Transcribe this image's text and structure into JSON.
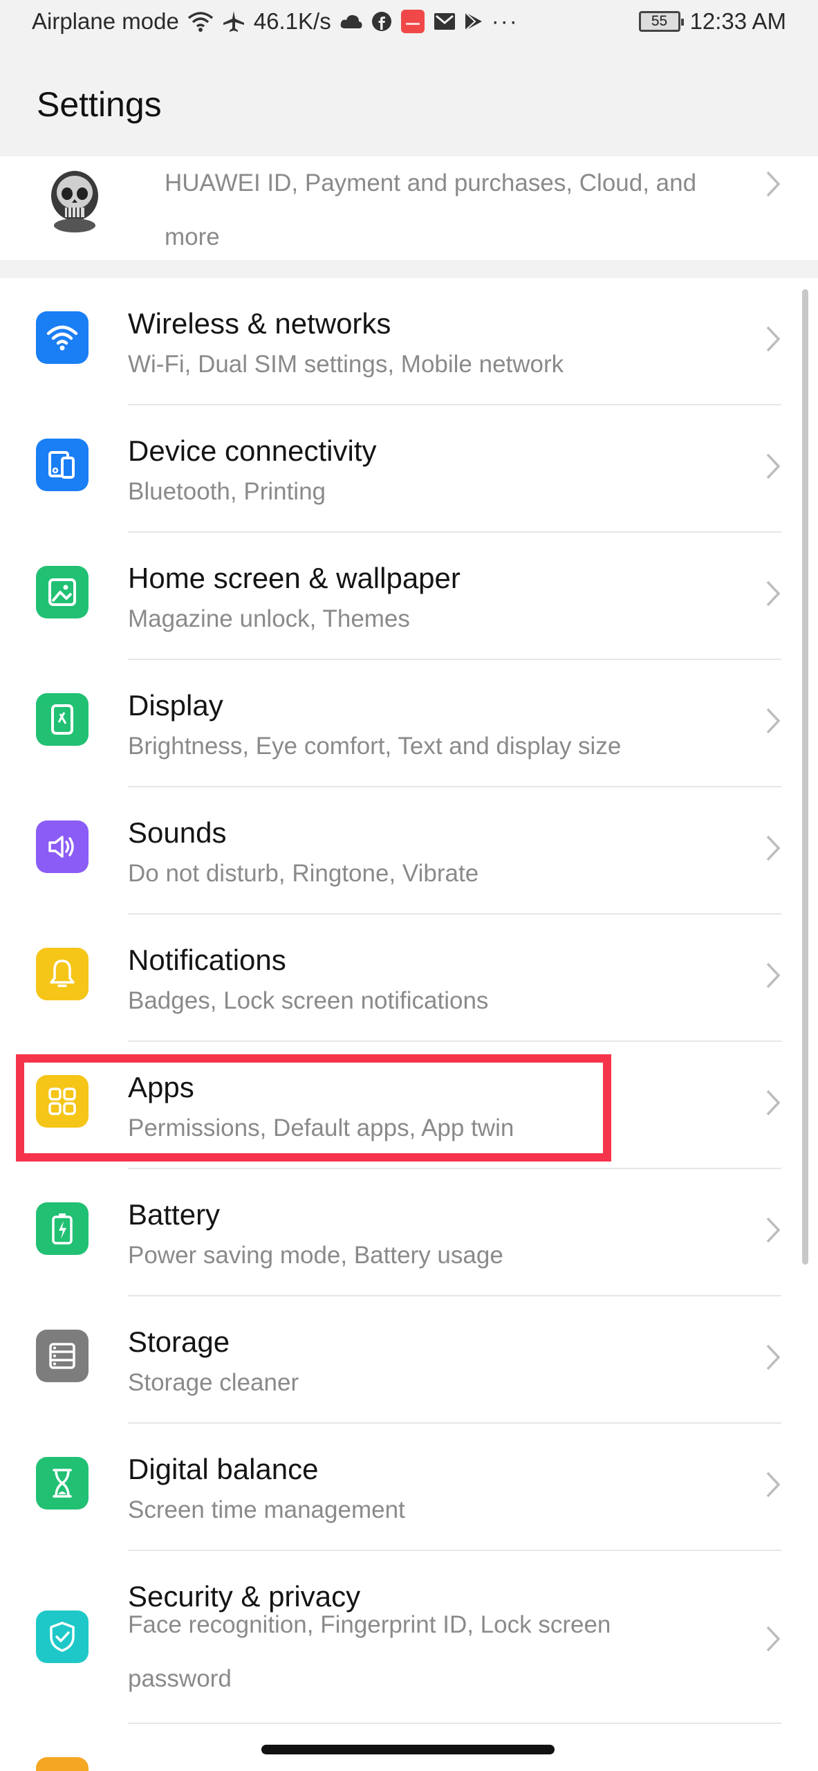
{
  "status_bar": {
    "airplane_text": "Airplane mode",
    "speed": "46.1K/s",
    "battery": "55",
    "time": "12:33 AM",
    "more": "···"
  },
  "header": {
    "title": "Settings"
  },
  "account": {
    "summary": "HUAWEI ID, Payment and purchases, Cloud, and more"
  },
  "items": [
    {
      "label": "Wireless & networks",
      "sub": "Wi-Fi, Dual SIM settings, Mobile network",
      "icon": "wifi-icon",
      "color": "#1a7ef5"
    },
    {
      "label": "Device connectivity",
      "sub": "Bluetooth, Printing",
      "icon": "device-connectivity-icon",
      "color": "#1a7ef5"
    },
    {
      "label": "Home screen & wallpaper",
      "sub": "Magazine unlock, Themes",
      "icon": "wallpaper-icon",
      "color": "#21c073"
    },
    {
      "label": "Display",
      "sub": "Brightness, Eye comfort, Text and display size",
      "icon": "display-icon",
      "color": "#21c073"
    },
    {
      "label": "Sounds",
      "sub": "Do not disturb, Ringtone, Vibrate",
      "icon": "speaker-icon",
      "color": "#8b5cf6"
    },
    {
      "label": "Notifications",
      "sub": "Badges, Lock screen notifications",
      "icon": "bell-icon",
      "color": "#f5c518"
    },
    {
      "label": "Apps",
      "sub": "Permissions, Default apps, App twin",
      "icon": "apps-grid-icon",
      "color": "#f5c518"
    },
    {
      "label": "Battery",
      "sub": "Power saving mode, Battery usage",
      "icon": "battery-icon",
      "color": "#21c073"
    },
    {
      "label": "Storage",
      "sub": "Storage cleaner",
      "icon": "storage-icon",
      "color": "#7d7d7d"
    },
    {
      "label": "Digital balance",
      "sub": "Screen time management",
      "icon": "hourglass-icon",
      "color": "#21c073"
    },
    {
      "label": "Security & privacy",
      "sub": "Face recognition, Fingerprint ID, Lock screen password",
      "icon": "shield-icon",
      "color": "#1ec8c8"
    }
  ]
}
